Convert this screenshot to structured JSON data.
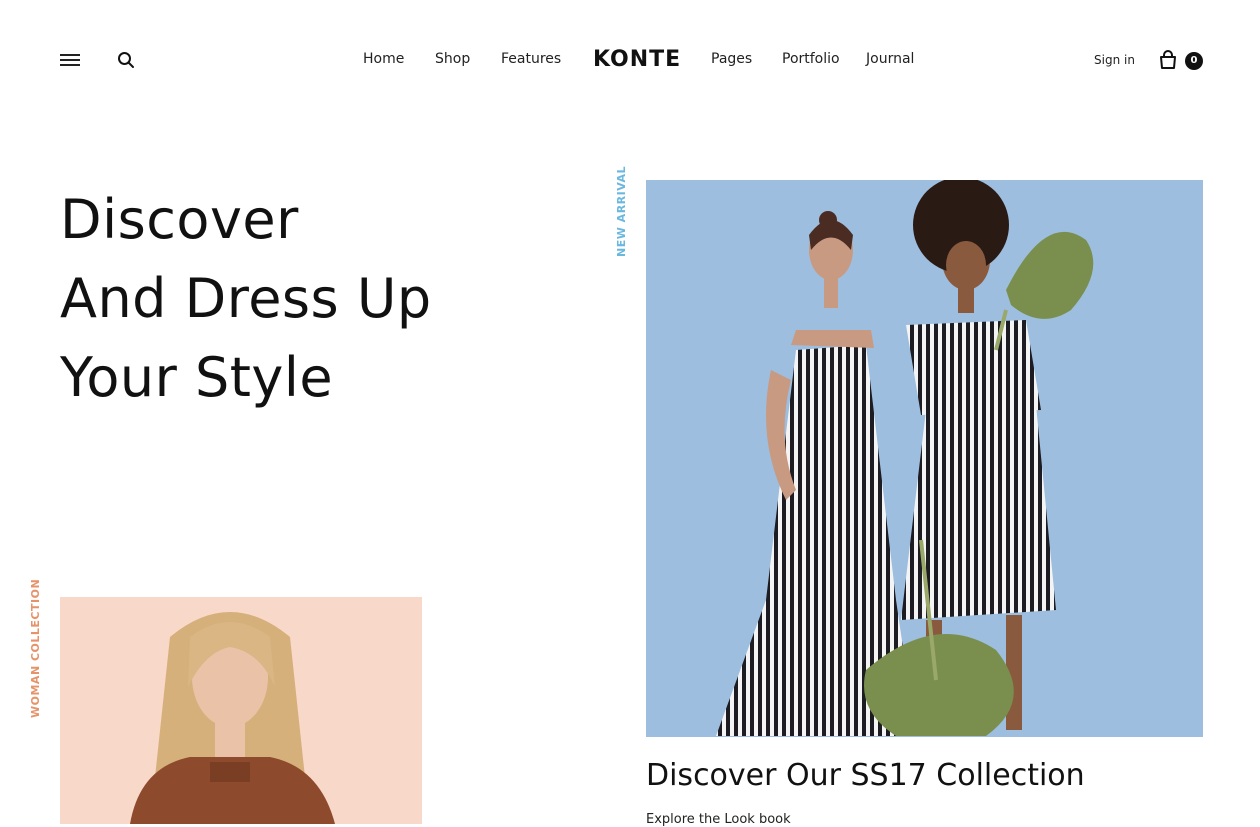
{
  "header": {
    "logo": "KONTE",
    "nav_left": [
      "Home",
      "Shop",
      "Features"
    ],
    "nav_right": [
      "Pages",
      "Portfolio",
      "Journal"
    ],
    "signin_label": "Sign in",
    "cart_count": "0",
    "icons": {
      "menu": "hamburger-menu-icon",
      "search": "search-icon",
      "cart": "shopping-bag-icon"
    }
  },
  "hero": {
    "lines": [
      "Discover",
      "And Dress Up",
      "Your Style"
    ]
  },
  "labels": {
    "new_arrival": "NEW ARRIVAL",
    "woman_collection": "WOMAN COLLECTION"
  },
  "feature": {
    "title": "Discover Our SS17 Collection",
    "subtitle": "Explore the Look book"
  },
  "colors": {
    "accent_blue": "#6ab7df",
    "accent_orange": "#e6936a",
    "main_photo_bg": "#9dbedf",
    "side_photo_bg": "#f8d8c8"
  }
}
